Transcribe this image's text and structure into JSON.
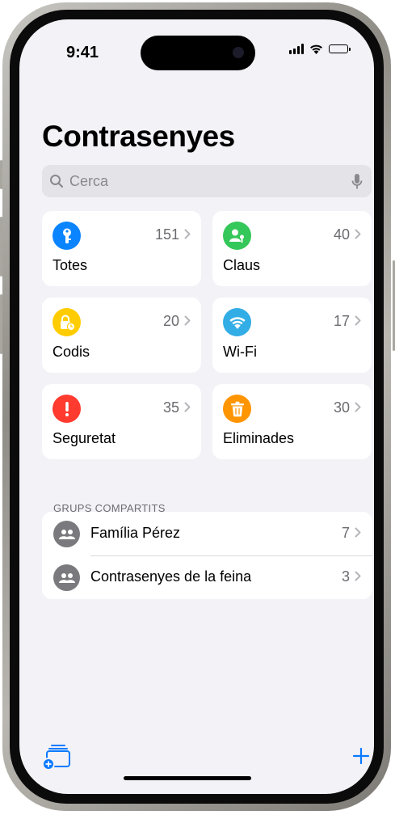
{
  "status_bar": {
    "time": "9:41"
  },
  "page": {
    "title": "Contrasenyes"
  },
  "search": {
    "placeholder": "Cerca"
  },
  "categories": [
    {
      "label": "Totes",
      "count": "151",
      "icon": "key-icon",
      "color": "#0a84ff"
    },
    {
      "label": "Claus",
      "count": "40",
      "icon": "person-key-icon",
      "color": "#34c759"
    },
    {
      "label": "Codis",
      "count": "20",
      "icon": "lock-clock-icon",
      "color": "#ffcc00"
    },
    {
      "label": "Wi-Fi",
      "count": "17",
      "icon": "wifi-icon",
      "color": "#32ade6"
    },
    {
      "label": "Seguretat",
      "count": "35",
      "icon": "exclamation-icon",
      "color": "#ff3b30"
    },
    {
      "label": "Eliminades",
      "count": "30",
      "icon": "trash-icon",
      "color": "#ff9500"
    }
  ],
  "shared_groups": {
    "header": "GRUPS COMPARTITS",
    "items": [
      {
        "name": "Família Pérez",
        "count": "7",
        "icon": "people-icon"
      },
      {
        "name": "Contrasenyes de la feina",
        "count": "3",
        "icon": "people-icon"
      }
    ]
  },
  "toolbar": {
    "left_icon": "new-group-icon",
    "right_icon": "plus-icon",
    "accent": "#0a7aff"
  }
}
